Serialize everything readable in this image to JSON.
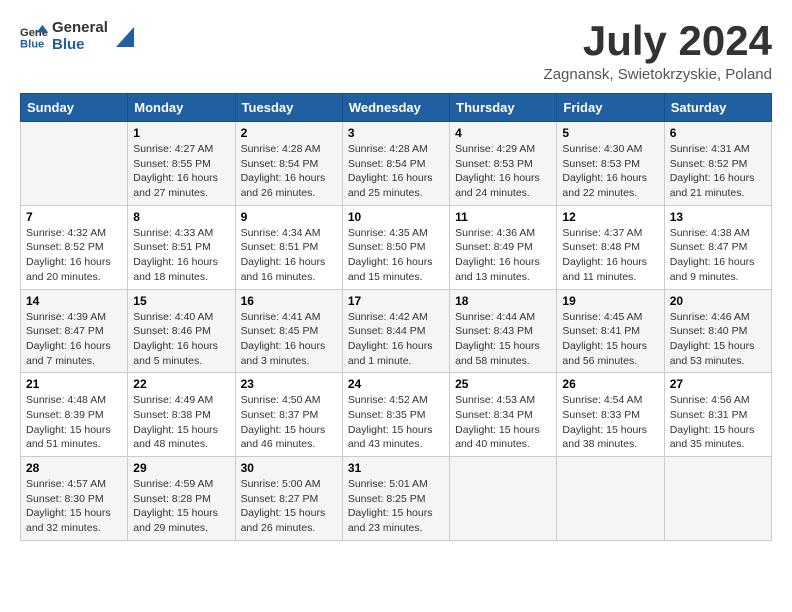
{
  "header": {
    "logo_general": "General",
    "logo_blue": "Blue",
    "title": "July 2024",
    "subtitle": "Zagnansk, Swietokrzyskie, Poland"
  },
  "weekdays": [
    "Sunday",
    "Monday",
    "Tuesday",
    "Wednesday",
    "Thursday",
    "Friday",
    "Saturday"
  ],
  "weeks": [
    [
      {
        "day": "",
        "sunrise": "",
        "sunset": "",
        "daylight": ""
      },
      {
        "day": "1",
        "sunrise": "Sunrise: 4:27 AM",
        "sunset": "Sunset: 8:55 PM",
        "daylight": "Daylight: 16 hours and 27 minutes."
      },
      {
        "day": "2",
        "sunrise": "Sunrise: 4:28 AM",
        "sunset": "Sunset: 8:54 PM",
        "daylight": "Daylight: 16 hours and 26 minutes."
      },
      {
        "day": "3",
        "sunrise": "Sunrise: 4:28 AM",
        "sunset": "Sunset: 8:54 PM",
        "daylight": "Daylight: 16 hours and 25 minutes."
      },
      {
        "day": "4",
        "sunrise": "Sunrise: 4:29 AM",
        "sunset": "Sunset: 8:53 PM",
        "daylight": "Daylight: 16 hours and 24 minutes."
      },
      {
        "day": "5",
        "sunrise": "Sunrise: 4:30 AM",
        "sunset": "Sunset: 8:53 PM",
        "daylight": "Daylight: 16 hours and 22 minutes."
      },
      {
        "day": "6",
        "sunrise": "Sunrise: 4:31 AM",
        "sunset": "Sunset: 8:52 PM",
        "daylight": "Daylight: 16 hours and 21 minutes."
      }
    ],
    [
      {
        "day": "7",
        "sunrise": "Sunrise: 4:32 AM",
        "sunset": "Sunset: 8:52 PM",
        "daylight": "Daylight: 16 hours and 20 minutes."
      },
      {
        "day": "8",
        "sunrise": "Sunrise: 4:33 AM",
        "sunset": "Sunset: 8:51 PM",
        "daylight": "Daylight: 16 hours and 18 minutes."
      },
      {
        "day": "9",
        "sunrise": "Sunrise: 4:34 AM",
        "sunset": "Sunset: 8:51 PM",
        "daylight": "Daylight: 16 hours and 16 minutes."
      },
      {
        "day": "10",
        "sunrise": "Sunrise: 4:35 AM",
        "sunset": "Sunset: 8:50 PM",
        "daylight": "Daylight: 16 hours and 15 minutes."
      },
      {
        "day": "11",
        "sunrise": "Sunrise: 4:36 AM",
        "sunset": "Sunset: 8:49 PM",
        "daylight": "Daylight: 16 hours and 13 minutes."
      },
      {
        "day": "12",
        "sunrise": "Sunrise: 4:37 AM",
        "sunset": "Sunset: 8:48 PM",
        "daylight": "Daylight: 16 hours and 11 minutes."
      },
      {
        "day": "13",
        "sunrise": "Sunrise: 4:38 AM",
        "sunset": "Sunset: 8:47 PM",
        "daylight": "Daylight: 16 hours and 9 minutes."
      }
    ],
    [
      {
        "day": "14",
        "sunrise": "Sunrise: 4:39 AM",
        "sunset": "Sunset: 8:47 PM",
        "daylight": "Daylight: 16 hours and 7 minutes."
      },
      {
        "day": "15",
        "sunrise": "Sunrise: 4:40 AM",
        "sunset": "Sunset: 8:46 PM",
        "daylight": "Daylight: 16 hours and 5 minutes."
      },
      {
        "day": "16",
        "sunrise": "Sunrise: 4:41 AM",
        "sunset": "Sunset: 8:45 PM",
        "daylight": "Daylight: 16 hours and 3 minutes."
      },
      {
        "day": "17",
        "sunrise": "Sunrise: 4:42 AM",
        "sunset": "Sunset: 8:44 PM",
        "daylight": "Daylight: 16 hours and 1 minute."
      },
      {
        "day": "18",
        "sunrise": "Sunrise: 4:44 AM",
        "sunset": "Sunset: 8:43 PM",
        "daylight": "Daylight: 15 hours and 58 minutes."
      },
      {
        "day": "19",
        "sunrise": "Sunrise: 4:45 AM",
        "sunset": "Sunset: 8:41 PM",
        "daylight": "Daylight: 15 hours and 56 minutes."
      },
      {
        "day": "20",
        "sunrise": "Sunrise: 4:46 AM",
        "sunset": "Sunset: 8:40 PM",
        "daylight": "Daylight: 15 hours and 53 minutes."
      }
    ],
    [
      {
        "day": "21",
        "sunrise": "Sunrise: 4:48 AM",
        "sunset": "Sunset: 8:39 PM",
        "daylight": "Daylight: 15 hours and 51 minutes."
      },
      {
        "day": "22",
        "sunrise": "Sunrise: 4:49 AM",
        "sunset": "Sunset: 8:38 PM",
        "daylight": "Daylight: 15 hours and 48 minutes."
      },
      {
        "day": "23",
        "sunrise": "Sunrise: 4:50 AM",
        "sunset": "Sunset: 8:37 PM",
        "daylight": "Daylight: 15 hours and 46 minutes."
      },
      {
        "day": "24",
        "sunrise": "Sunrise: 4:52 AM",
        "sunset": "Sunset: 8:35 PM",
        "daylight": "Daylight: 15 hours and 43 minutes."
      },
      {
        "day": "25",
        "sunrise": "Sunrise: 4:53 AM",
        "sunset": "Sunset: 8:34 PM",
        "daylight": "Daylight: 15 hours and 40 minutes."
      },
      {
        "day": "26",
        "sunrise": "Sunrise: 4:54 AM",
        "sunset": "Sunset: 8:33 PM",
        "daylight": "Daylight: 15 hours and 38 minutes."
      },
      {
        "day": "27",
        "sunrise": "Sunrise: 4:56 AM",
        "sunset": "Sunset: 8:31 PM",
        "daylight": "Daylight: 15 hours and 35 minutes."
      }
    ],
    [
      {
        "day": "28",
        "sunrise": "Sunrise: 4:57 AM",
        "sunset": "Sunset: 8:30 PM",
        "daylight": "Daylight: 15 hours and 32 minutes."
      },
      {
        "day": "29",
        "sunrise": "Sunrise: 4:59 AM",
        "sunset": "Sunset: 8:28 PM",
        "daylight": "Daylight: 15 hours and 29 minutes."
      },
      {
        "day": "30",
        "sunrise": "Sunrise: 5:00 AM",
        "sunset": "Sunset: 8:27 PM",
        "daylight": "Daylight: 15 hours and 26 minutes."
      },
      {
        "day": "31",
        "sunrise": "Sunrise: 5:01 AM",
        "sunset": "Sunset: 8:25 PM",
        "daylight": "Daylight: 15 hours and 23 minutes."
      },
      {
        "day": "",
        "sunrise": "",
        "sunset": "",
        "daylight": ""
      },
      {
        "day": "",
        "sunrise": "",
        "sunset": "",
        "daylight": ""
      },
      {
        "day": "",
        "sunrise": "",
        "sunset": "",
        "daylight": ""
      }
    ]
  ]
}
